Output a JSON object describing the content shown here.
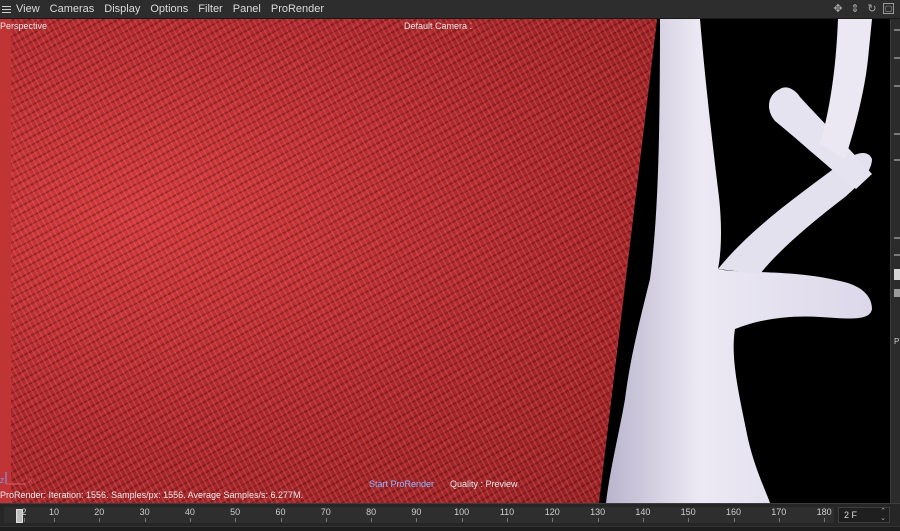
{
  "menubar": {
    "items": [
      "View",
      "Cameras",
      "Display",
      "Options",
      "Filter",
      "Panel",
      "ProRender"
    ],
    "icons": [
      "move-icon",
      "pan-icon",
      "rotate-icon",
      "maximize-icon"
    ]
  },
  "viewport": {
    "projection": "Perspective",
    "camera": "Default Camera",
    "camera_icon": "dots",
    "status": "ProRender: Iteration: 1556. Samples/px: 1556. Average Samples/s: 6.277M.",
    "start_button": "Start ProRender",
    "quality": "Quality : Preview",
    "axis": {
      "z": "Z",
      "x": "X"
    }
  },
  "right_panel": {
    "label": "P"
  },
  "timeline": {
    "ticks": [
      "2",
      "10",
      "20",
      "30",
      "40",
      "50",
      "60",
      "70",
      "80",
      "90",
      "100",
      "110",
      "120",
      "130",
      "140",
      "150",
      "160",
      "170",
      "180"
    ],
    "playhead_value": "0",
    "current_frame": "2 F"
  },
  "colors": {
    "fabric": "#a8272b",
    "tree": "#e9e6f2",
    "accent_link": "#8fb6ff"
  }
}
